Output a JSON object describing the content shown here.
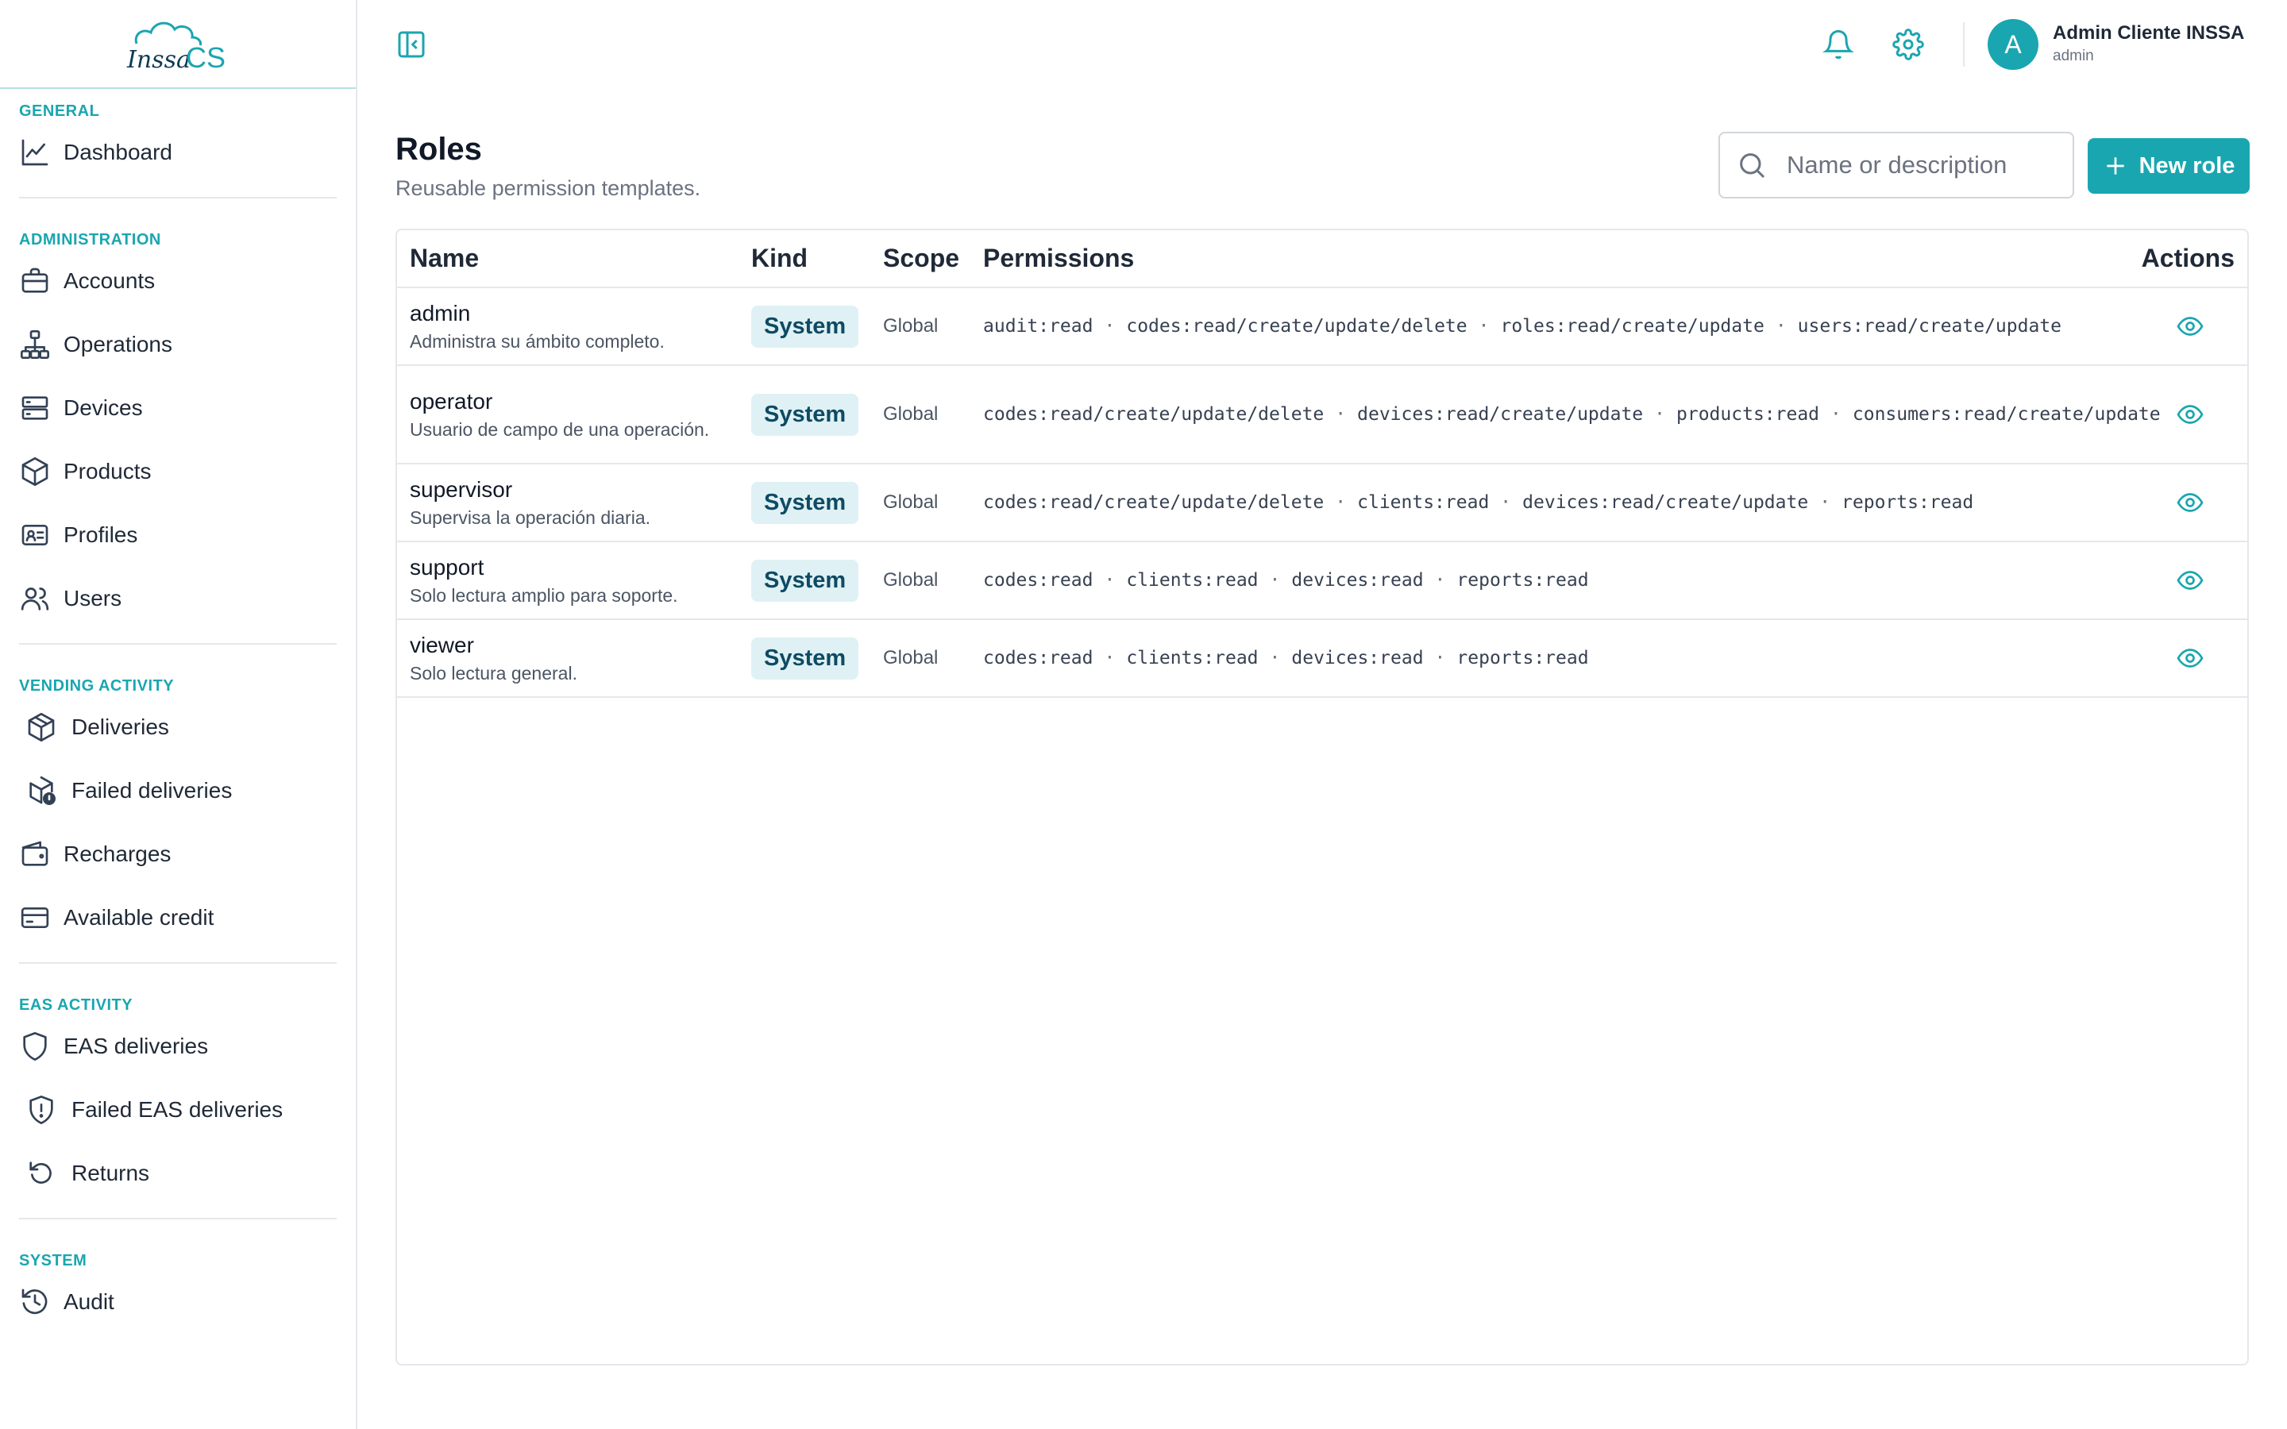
{
  "brand": {
    "logo_text_left": "Inssa",
    "logo_text_right": "CS",
    "accent": "#1aa6b0"
  },
  "sidebar": {
    "sections": [
      {
        "heading": "GENERAL",
        "items": [
          {
            "label": "Dashboard",
            "icon": "chart-line-icon"
          }
        ]
      },
      {
        "heading": "ADMINISTRATION",
        "items": [
          {
            "label": "Accounts",
            "icon": "briefcase-icon"
          },
          {
            "label": "Operations",
            "icon": "hierarchy-icon"
          },
          {
            "label": "Devices",
            "icon": "server-icon"
          },
          {
            "label": "Products",
            "icon": "cube-icon"
          },
          {
            "label": "Profiles",
            "icon": "id-card-icon"
          },
          {
            "label": "Users",
            "icon": "users-icon"
          }
        ]
      },
      {
        "heading": "VENDING ACTIVITY",
        "items": [
          {
            "label": "Deliveries",
            "icon": "package-icon"
          },
          {
            "label": "Failed deliveries",
            "icon": "package-alert-icon"
          },
          {
            "label": "Recharges",
            "icon": "wallet-icon"
          },
          {
            "label": "Available credit",
            "icon": "credit-card-icon"
          }
        ]
      },
      {
        "heading": "EAS ACTIVITY",
        "items": [
          {
            "label": "EAS deliveries",
            "icon": "shield-icon"
          },
          {
            "label": "Failed EAS deliveries",
            "icon": "shield-alert-icon"
          },
          {
            "label": "Returns",
            "icon": "rotate-ccw-icon"
          }
        ]
      },
      {
        "heading": "SYSTEM",
        "items": [
          {
            "label": "Audit",
            "icon": "history-icon"
          }
        ]
      }
    ]
  },
  "topbar": {
    "user_initial": "A",
    "user_name": "Admin Cliente INSSA",
    "user_role": "admin"
  },
  "page": {
    "title": "Roles",
    "subtitle": "Reusable permission templates.",
    "search_placeholder": "Name or description",
    "new_button": "New role"
  },
  "table": {
    "headers": {
      "name": "Name",
      "kind": "Kind",
      "scope": "Scope",
      "permissions": "Permissions",
      "actions": "Actions"
    },
    "rows": [
      {
        "name": "admin",
        "description": "Administra su ámbito completo.",
        "kind": "System",
        "scope": "Global",
        "permissions": [
          "audit:read",
          "codes:read/create/update/delete",
          "roles:read/create/update",
          "users:read/create/update"
        ]
      },
      {
        "name": "operator",
        "description": "Usuario de campo de una operación.",
        "kind": "System",
        "scope": "Global",
        "permissions": [
          "codes:read/create/update/delete",
          "devices:read/create/update",
          "products:read",
          "consumers:read/create/update"
        ]
      },
      {
        "name": "supervisor",
        "description": "Supervisa la operación diaria.",
        "kind": "System",
        "scope": "Global",
        "permissions": [
          "codes:read/create/update/delete",
          "clients:read",
          "devices:read/create/update",
          "reports:read"
        ]
      },
      {
        "name": "support",
        "description": "Solo lectura amplio para soporte.",
        "kind": "System",
        "scope": "Global",
        "permissions": [
          "codes:read",
          "clients:read",
          "devices:read",
          "reports:read"
        ]
      },
      {
        "name": "viewer",
        "description": "Solo lectura general.",
        "kind": "System",
        "scope": "Global",
        "permissions": [
          "codes:read",
          "clients:read",
          "devices:read",
          "reports:read"
        ]
      }
    ]
  }
}
